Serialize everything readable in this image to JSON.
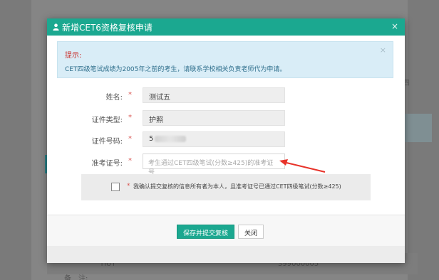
{
  "background": {
    "side_text": "四",
    "row_label": "备　注:",
    "row_value_left": "TIUT",
    "row_value_right": "399000005"
  },
  "modal": {
    "title": "新增CET6资格复核申请",
    "close_symbol": "×",
    "alert": {
      "title": "提示:",
      "text": "CET四级笔试成绩为2005年之前的考生，请联系学校相关负责老师代为申请。",
      "close_symbol": "×"
    },
    "fields": [
      {
        "label": "姓名:",
        "required_mark": "*",
        "value": "测试五"
      },
      {
        "label": "证件类型:",
        "required_mark": "*",
        "value": "护照"
      },
      {
        "label": "证件号码:",
        "required_mark": "*",
        "value": "5"
      },
      {
        "label": "准考证号:",
        "required_mark": "*",
        "placeholder": "考生通过CET四级笔试(分数≥425)的准考证号"
      }
    ],
    "confirm": {
      "required_mark": "*",
      "text": "我确认提交复核的信息所有者为本人，且准考证号已通过CET四级笔试(分数≥425)",
      "checked": false
    },
    "buttons": {
      "submit": "保存并提交复核",
      "close": "关闭"
    }
  },
  "colors": {
    "header": "#1ba890",
    "alert_bg": "#d9edf7",
    "required": "#d9534f",
    "annotation_arrow": "#e8332a"
  },
  "icons": {
    "title_icon": "user-icon",
    "annotation": "red-arrow-icon"
  }
}
